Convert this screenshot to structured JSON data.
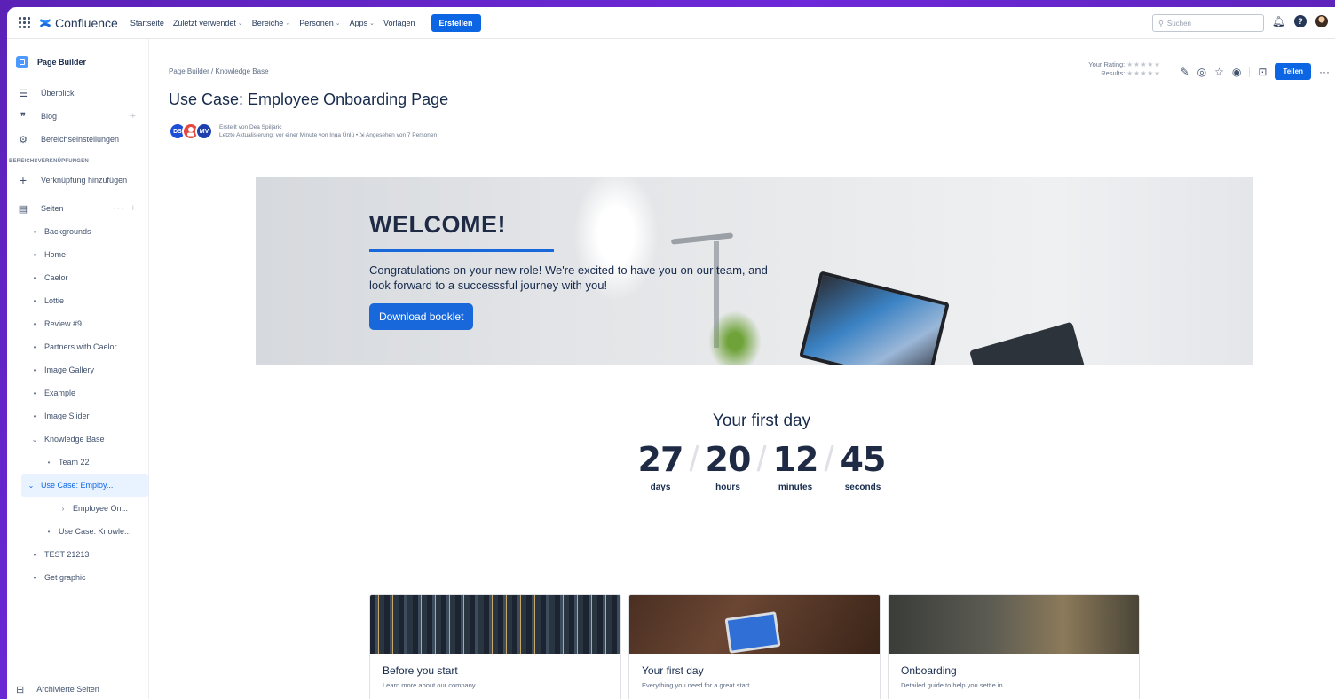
{
  "topnav": {
    "brand": "Confluence",
    "items": [
      {
        "label": "Startseite",
        "chevron": false
      },
      {
        "label": "Zuletzt verwendet",
        "chevron": true
      },
      {
        "label": "Bereiche",
        "chevron": true
      },
      {
        "label": "Personen",
        "chevron": true
      },
      {
        "label": "Apps",
        "chevron": true
      },
      {
        "label": "Vorlagen",
        "chevron": false
      }
    ],
    "create_label": "Erstellen",
    "search_placeholder": "Suchen"
  },
  "sidebar": {
    "space_name": "Page Builder",
    "items": [
      {
        "icon": "overview-icon",
        "label": "Überblick"
      },
      {
        "icon": "blog-icon",
        "label": "Blog"
      },
      {
        "icon": "settings-icon",
        "label": "Bereichseinstellungen"
      }
    ],
    "section_title": "BEREICHSVERKNÜPFUNGEN",
    "add_shortcut_label": "Verknüpfung hinzufügen",
    "pages_label": "Seiten",
    "tree": [
      {
        "label": "Backgrounds",
        "level": 0,
        "bullet": "•"
      },
      {
        "label": "Home",
        "level": 0,
        "bullet": "•"
      },
      {
        "label": "Caelor",
        "level": 0,
        "bullet": "•"
      },
      {
        "label": "Lottie",
        "level": 0,
        "bullet": "•"
      },
      {
        "label": "Review #9",
        "level": 0,
        "bullet": "•"
      },
      {
        "label": "Partners with Caelor",
        "level": 0,
        "bullet": "•"
      },
      {
        "label": "Image Gallery",
        "level": 0,
        "bullet": "•"
      },
      {
        "label": "Example",
        "level": 0,
        "bullet": "•"
      },
      {
        "label": "Image Slider",
        "level": 0,
        "bullet": "•"
      },
      {
        "label": "Knowledge Base",
        "level": 0,
        "bullet": "⌄"
      },
      {
        "label": "Team 22",
        "level": 1,
        "bullet": "•"
      },
      {
        "label": "Use Case: Employ...",
        "level": 1,
        "bullet": "⌄",
        "selected": true
      },
      {
        "label": "Employee On...",
        "level": 2,
        "bullet": "›"
      },
      {
        "label": "Use Case: Knowle...",
        "level": 1,
        "bullet": "•"
      },
      {
        "label": "TEST 21213",
        "level": 0,
        "bullet": "•"
      },
      {
        "label": "Get graphic",
        "level": 0,
        "bullet": "•"
      }
    ],
    "archived_label": "Archivierte Seiten"
  },
  "page": {
    "breadcrumb": "Page Builder  /  Knowledge Base",
    "title": "Use Case: Employee Onboarding Page",
    "avatars": [
      "DS",
      "",
      "MV"
    ],
    "created_by": "Erstellt von Dea Spiljaric",
    "last_update": "Letzte Aktualisierung: vor einer Minute von Inga Ünlü •  ⇲  Angesehen von 7 Personen",
    "rating_label": "Your Rating:",
    "results_label": "Results:",
    "stars": "★★★★★",
    "share_label": "Teilen"
  },
  "hero": {
    "title": "WELCOME!",
    "text": "Congratulations on your new role! We're excited to have you on our team, and look forward to a successsful journey with you!",
    "button_label": "Download booklet"
  },
  "countdown": {
    "title": "Your first day",
    "units": [
      {
        "value": "27",
        "label": "days"
      },
      {
        "value": "20",
        "label": "hours"
      },
      {
        "value": "12",
        "label": "minutes"
      },
      {
        "value": "45",
        "label": "seconds"
      }
    ]
  },
  "cards": [
    {
      "title": "Before you start",
      "desc": "Learn more about our company."
    },
    {
      "title": "Your first day",
      "desc": "Everything you need for a great start."
    },
    {
      "title": "Onboarding",
      "desc": "Detailed guide to help you settle in."
    }
  ],
  "colors": {
    "accent": "#0c66e4",
    "frame": "#6d28d9"
  }
}
